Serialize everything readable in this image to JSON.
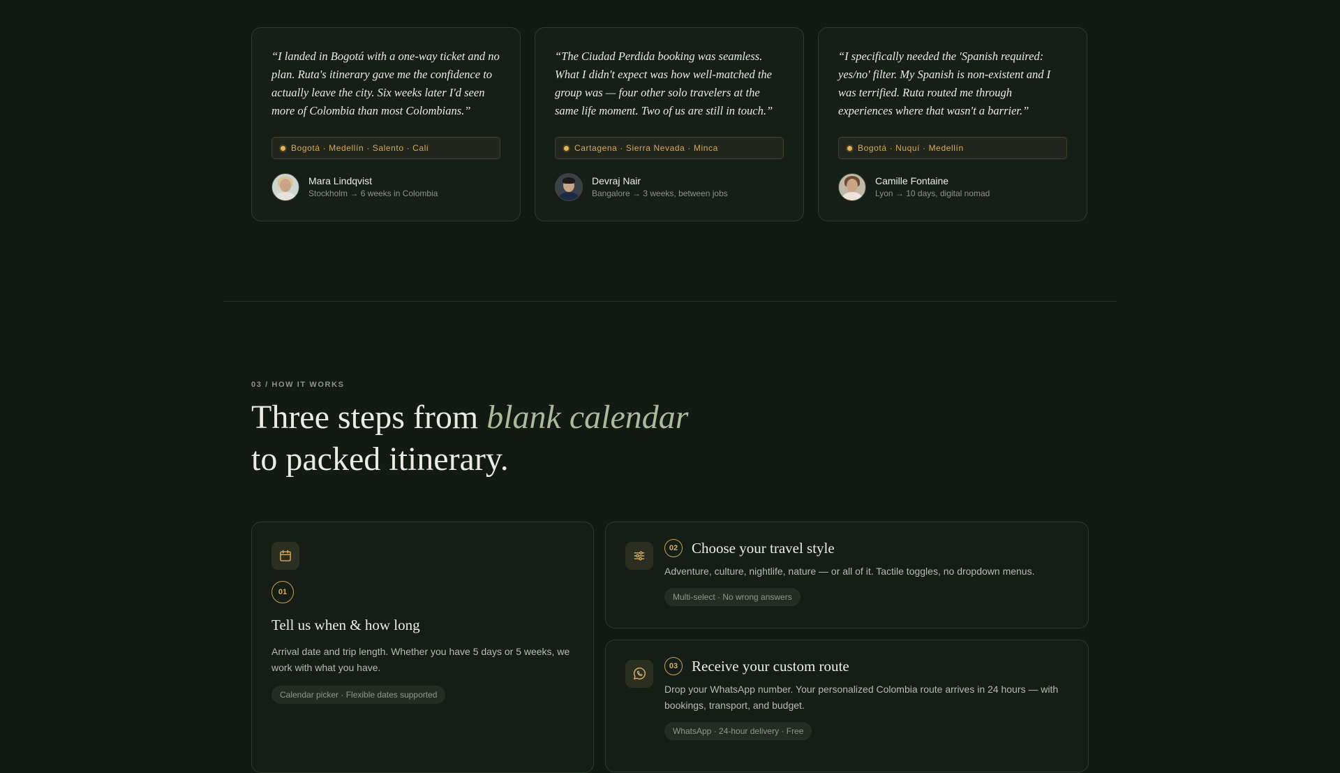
{
  "testimonials": [
    {
      "quote": "“I landed in Bogotá with a one-way ticket and no plan. Ruta's itinerary gave me the confidence to actually leave the city. Six weeks later I'd seen more of Colombia than most Colombians.”",
      "route": "Bogotá · Medellín · Salento · Cali",
      "name": "Mara Lindqvist",
      "meta": "Stockholm → 6 weeks in Colombia"
    },
    {
      "quote": "“The Ciudad Perdida booking was seamless. What I didn't expect was how well-matched the group was — four other solo travelers at the same life moment. Two of us are still in touch.”",
      "route": "Cartagena · Sierra Nevada · Minca",
      "name": "Devraj Nair",
      "meta": "Bangalore → 3 weeks, between jobs"
    },
    {
      "quote": "“I specifically needed the 'Spanish required: yes/no' filter. My Spanish is non-existent and I was terrified. Ruta routed me through experiences where that wasn't a barrier.”",
      "route": "Bogotá · Nuquí · Medellín",
      "name": "Camille Fontaine",
      "meta": "Lyon → 10 days, digital nomad"
    }
  ],
  "how": {
    "eyebrow": "03 / HOW IT WORKS",
    "headline_a": "Three steps from ",
    "headline_em": "blank calendar",
    "headline_b": " to packed itinerary."
  },
  "steps": [
    {
      "num": "01",
      "icon": "calendar-icon",
      "title": "Tell us when & how long",
      "desc": "Arrival date and trip length. Whether you have 5 days or 5 weeks, we work with what you have.",
      "pill": "Calendar picker · Flexible dates supported"
    },
    {
      "num": "02",
      "icon": "sliders-icon",
      "title": "Choose your travel style",
      "desc": "Adventure, culture, nightlife, nature — or all of it. Tactile toggles, no dropdown menus.",
      "pill": "Multi-select · No wrong answers"
    },
    {
      "num": "03",
      "icon": "whatsapp-icon",
      "title": "Receive your custom route",
      "desc": "Drop your WhatsApp number. Your personalized Colombia route arrives in 24 hours — with bookings, transport, and budget.",
      "pill": "WhatsApp · 24-hour delivery · Free"
    }
  ],
  "colors": {
    "background": "#121a13",
    "accent": "#d8ad5e",
    "sage": "#a8bb9a"
  }
}
